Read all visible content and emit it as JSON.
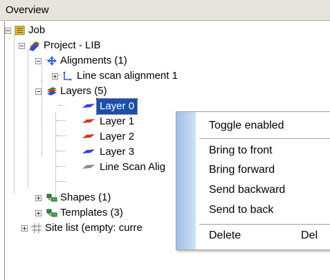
{
  "panel": {
    "title": "Overview"
  },
  "tree": {
    "job": "Job",
    "project": "Project - LIB",
    "alignments": "Alignments (1)",
    "line_scan_alignment": "Line scan alignment 1",
    "layers": "Layers (5)",
    "layer_items": [
      "Layer 0",
      "Layer 1",
      "Layer 2",
      "Layer 3",
      "Line Scan Alig"
    ],
    "layer_colors": [
      "#3344d8",
      "#e0301e",
      "#e0301e",
      "#3344d8",
      "#888888"
    ],
    "shapes": "Shapes (1)",
    "templates": "Templates (3)",
    "site_list": "Site list (empty: curre",
    "selected_item": "Layer 0"
  },
  "context_menu": {
    "toggle_enabled": "Toggle enabled",
    "bring_to_front": "Bring to front",
    "bring_forward": "Bring forward",
    "send_backward": "Send backward",
    "send_to_back": "Send to back",
    "delete": "Delete",
    "delete_shortcut": "Del"
  }
}
